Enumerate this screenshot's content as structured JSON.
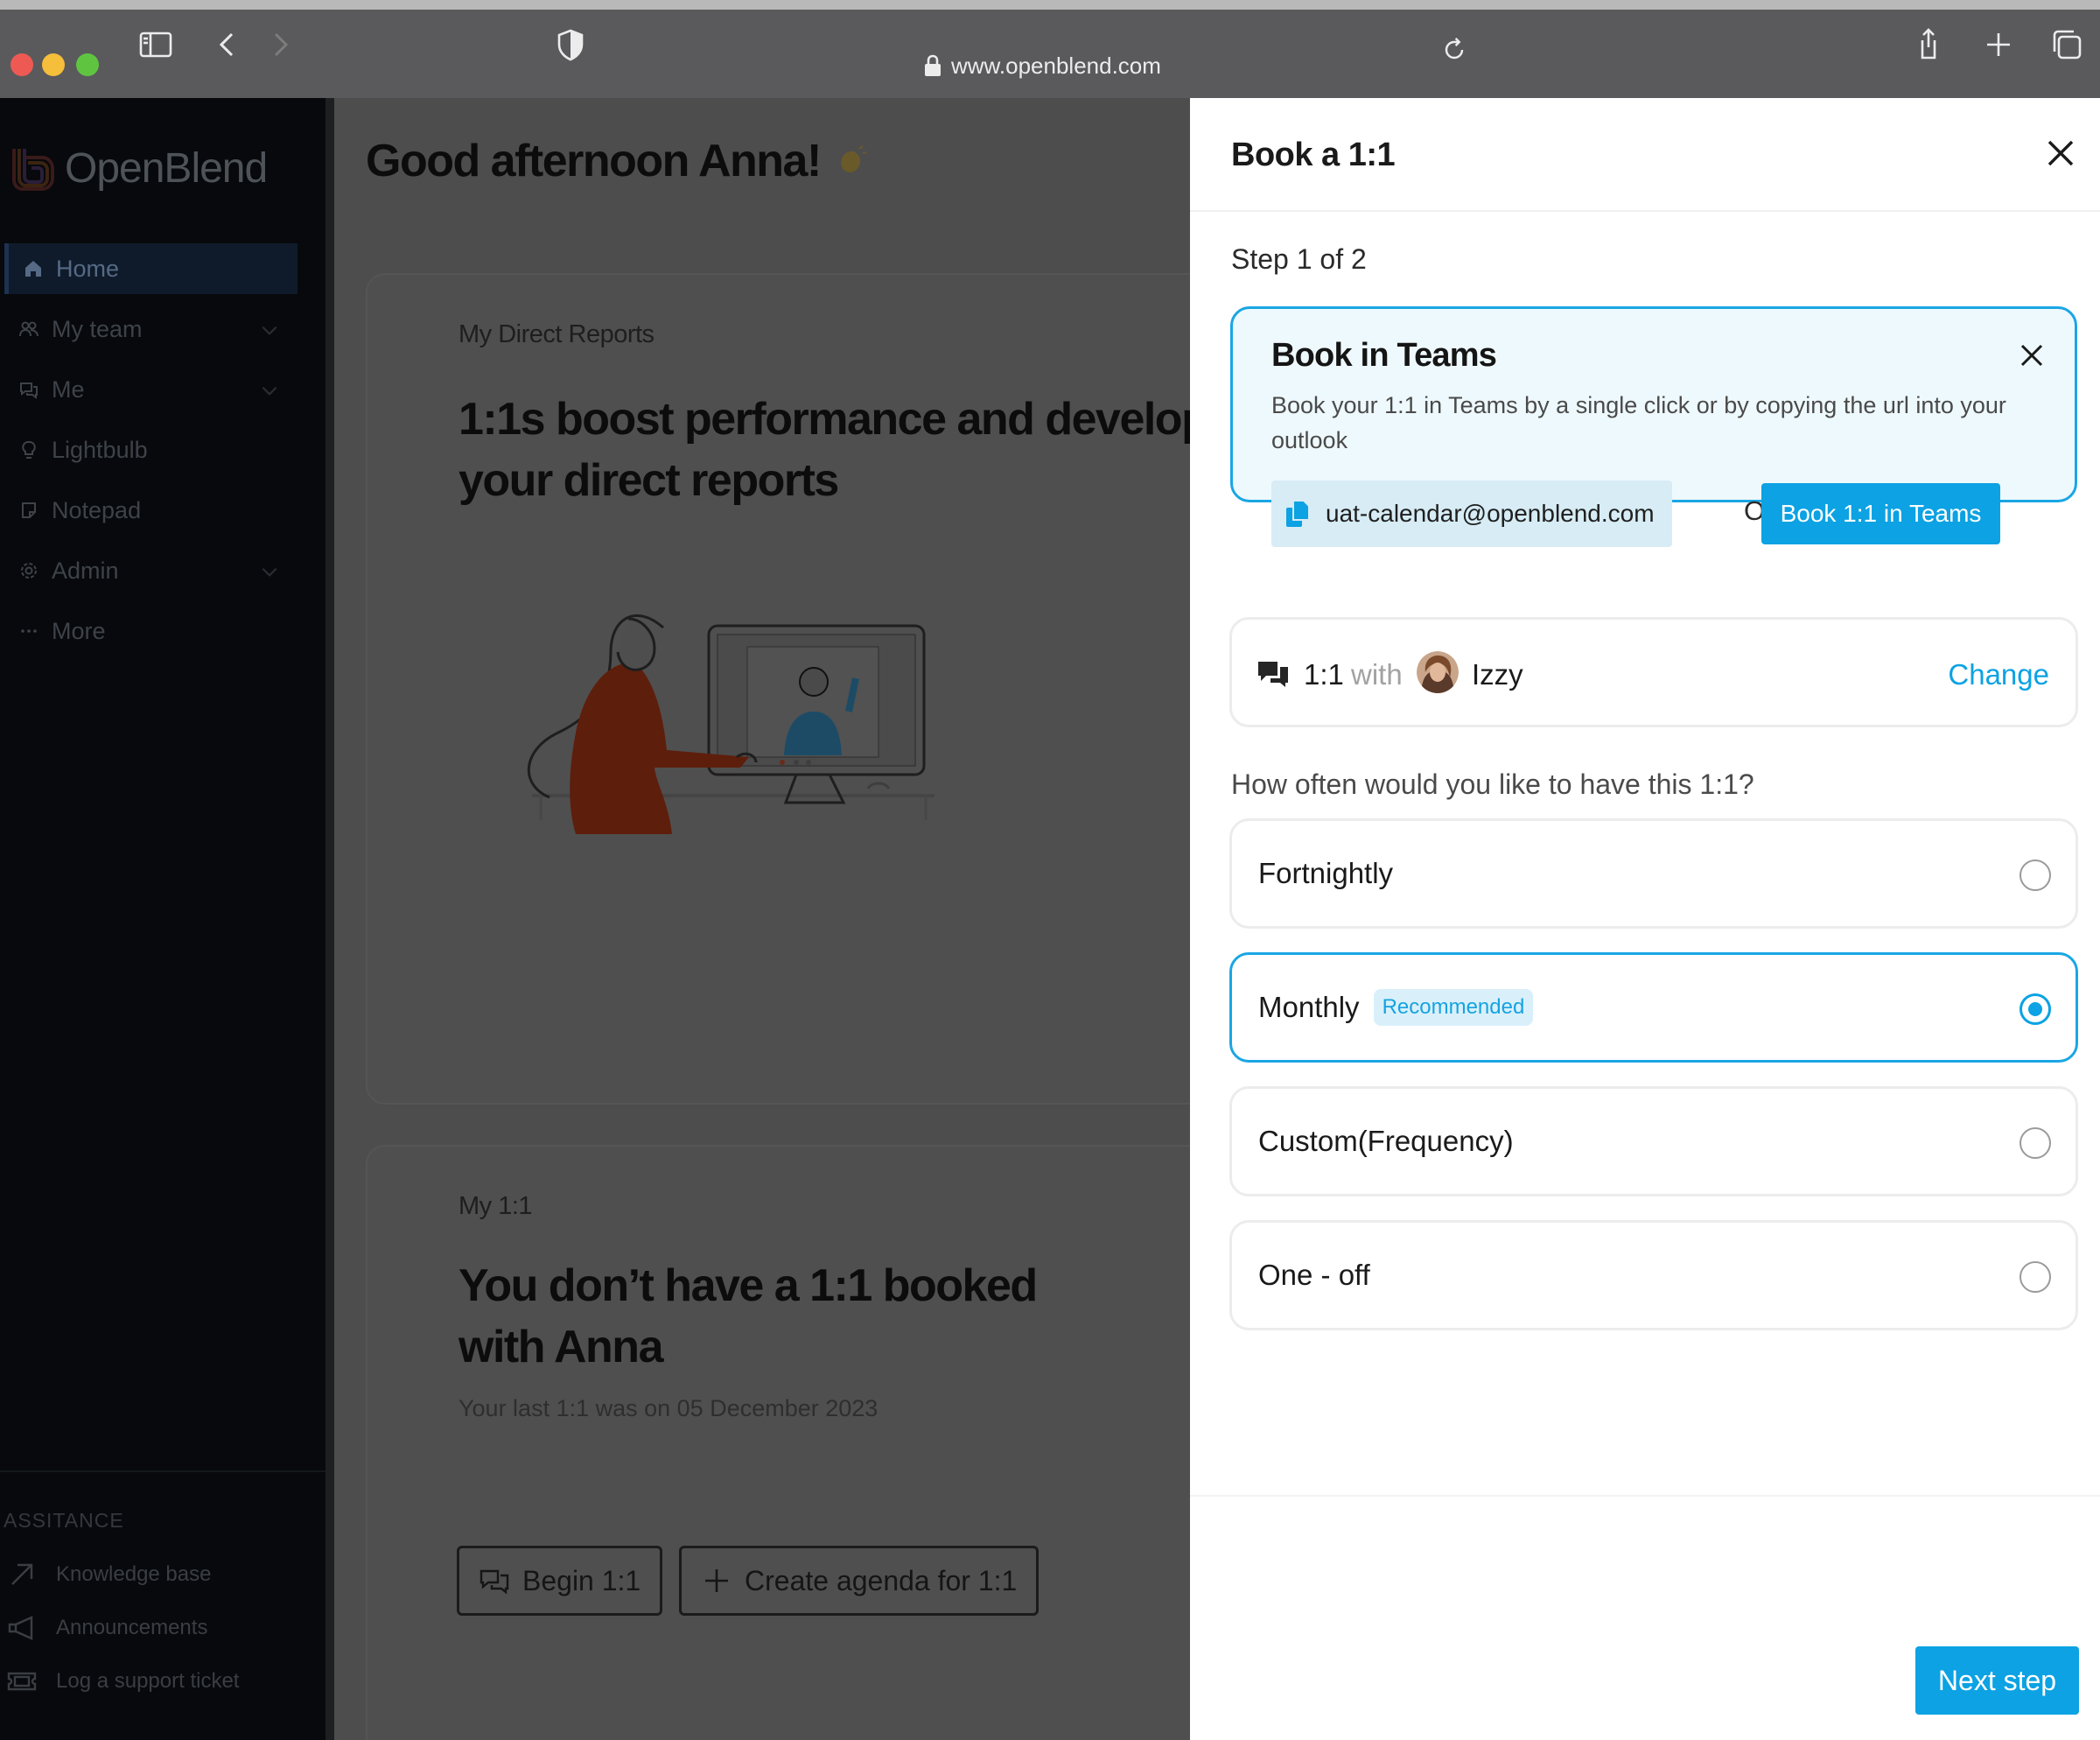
{
  "browser": {
    "url": "www.openblend.com"
  },
  "sidebar": {
    "logo_text": "OpenBlend",
    "items": [
      {
        "label": "Home",
        "icon": "home-icon"
      },
      {
        "label": "My team",
        "icon": "team-icon"
      },
      {
        "label": "Me",
        "icon": "chat-icon"
      },
      {
        "label": "Lightbulb",
        "icon": "lightbulb-icon"
      },
      {
        "label": "Notepad",
        "icon": "notepad-icon"
      },
      {
        "label": "Admin",
        "icon": "gear-icon"
      },
      {
        "label": "More",
        "icon": "ellipsis-icon"
      }
    ],
    "assistance_label": "ASSITANCE",
    "assistance_items": [
      {
        "label": "Knowledge base",
        "icon": "arrow-up-right-icon"
      },
      {
        "label": "Announcements",
        "icon": "megaphone-icon"
      },
      {
        "label": "Log a support ticket",
        "icon": "ticket-icon"
      }
    ]
  },
  "main": {
    "greeting": "Good afternoon Anna!",
    "card1": {
      "eyebrow": "My Direct Reports",
      "heading_line1": "1:1s boost performance and develop",
      "heading_line2": "your direct reports"
    },
    "card2": {
      "eyebrow": "My 1:1",
      "heading_line1": "You don’t have a 1:1 booked",
      "heading_line2": "with Anna",
      "subtext": "Your last 1:1 was on 05 December 2023",
      "begin_label": "Begin 1:1",
      "agenda_label": "Create agenda for 1:1"
    }
  },
  "panel": {
    "title": "Book a 1:1",
    "step": "Step 1 of 2",
    "teams": {
      "title": "Book in Teams",
      "description": "Book your 1:1 in Teams by a single click or by copying the url into your outlook",
      "email": "uat-calendar@openblend.com",
      "or_label": "Or",
      "button_label": "Book 1:1 in Teams"
    },
    "with_row": {
      "meeting": "1:1",
      "with_word": "with",
      "person": "Izzy",
      "change_label": "Change"
    },
    "question": "How often would you like to have this 1:1?",
    "options": [
      {
        "label": "Fortnightly",
        "badge": "",
        "selected": false
      },
      {
        "label": "Monthly",
        "badge": "Recommended",
        "selected": true
      },
      {
        "label": "Custom(Frequency)",
        "badge": "",
        "selected": false
      },
      {
        "label": "One - off",
        "badge": "",
        "selected": false
      }
    ],
    "next_label": "Next step"
  },
  "colors": {
    "accent": "#0ca2e3",
    "panel_bg": "#ffffff",
    "overlay_main": "#4d4d4d",
    "sidebar_bg": "#07090c"
  }
}
